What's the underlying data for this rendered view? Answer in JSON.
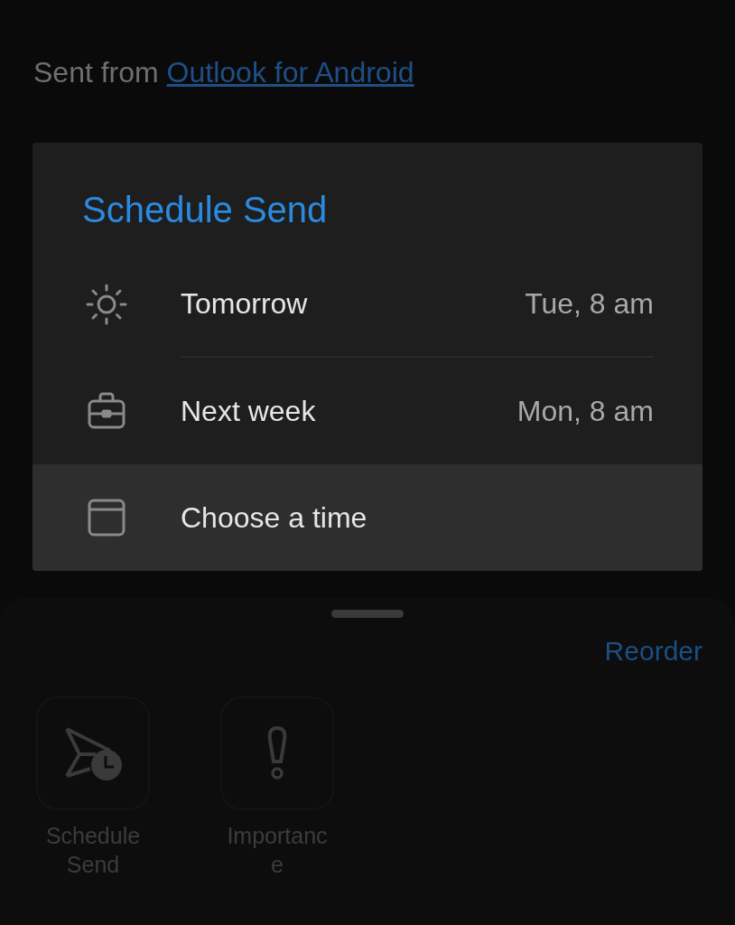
{
  "message": {
    "prefix": "Sent from ",
    "link": "Outlook for Android"
  },
  "dialog": {
    "title": "Schedule Send",
    "options": [
      {
        "kind": "sun",
        "label": "Tomorrow",
        "time": "Tue, 8 am",
        "selected": false
      },
      {
        "kind": "briefcase",
        "label": "Next week",
        "time": "Mon, 8 am",
        "selected": false
      },
      {
        "kind": "calendar",
        "label": "Choose a time",
        "selected": true
      }
    ]
  },
  "sheet": {
    "reorder": "Reorder",
    "actions": [
      {
        "kind": "schedule",
        "label": "Schedule Send"
      },
      {
        "kind": "importance",
        "label": "Importance"
      }
    ]
  }
}
